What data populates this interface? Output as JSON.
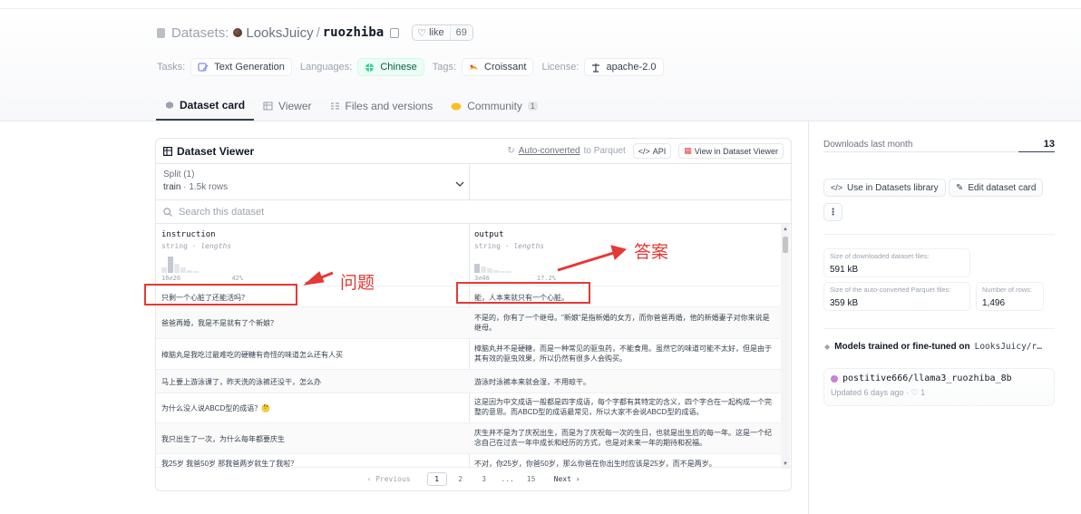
{
  "header": {
    "datasets_label": "Datasets:",
    "owner": "LooksJuicy",
    "slash": "/",
    "repo": "ruozhiba",
    "like_label": "like",
    "like_count": "69"
  },
  "tags": {
    "tasks_label": "Tasks:",
    "task": "Text Generation",
    "languages_label": "Languages:",
    "language": "Chinese",
    "tags_label": "Tags:",
    "tag": "Croissant",
    "license_label": "License:",
    "license": "apache-2.0"
  },
  "tabs": [
    {
      "label": "Dataset card"
    },
    {
      "label": "Viewer"
    },
    {
      "label": "Files and versions"
    },
    {
      "label": "Community",
      "badge": "1"
    }
  ],
  "viewer": {
    "title": "Dataset Viewer",
    "auto_converted_link": "Auto-converted",
    "auto_converted_suffix": "to Parquet",
    "api_label": "API",
    "view_label": "View in Dataset Viewer",
    "split_label": "Split (1)",
    "split_name": "train",
    "split_rows": "· 1.5k rows",
    "search_placeholder": "Search this dataset",
    "columns": [
      {
        "name": "instruction",
        "type": "string",
        "sub": "lengths",
        "min": "16⌀26",
        "pct": "42%"
      },
      {
        "name": "output",
        "type": "string",
        "sub": "lengths",
        "min": "3⌀46",
        "pct": "17.2%"
      }
    ],
    "rows": [
      [
        "只剩一个心脏了还能活吗？",
        "能，人本来就只有一个心脏。"
      ],
      [
        "爸爸再婚，我是不是就有了个新娘？",
        "不是的，你有了一个继母。\"新娘\"是指新婚的女方，而你爸爸再婚，他的新婚妻子对你来说是继母。"
      ],
      [
        "樟脑丸是我吃过最难吃的硬糖有奇怪的味道怎么还有人买",
        "樟脑丸并不是硬糖，而是一种常见的驱虫药，不能食用。虽然它的味道可能不太好，但是由于其有效的驱虫效果，所以仍然有很多人会购买。"
      ],
      [
        "马上要上游泳课了，昨天洗的泳裤还没干，怎么办",
        "游泳时泳裤本来就会湿，不用晾干。"
      ],
      [
        "为什么没人说ABCD型的成语？🤔",
        "这是因为中文成语一般都是四字成语，每个字都有其特定的含义，四个字合在一起构成一个完整的意思。而ABCD型的成语最常见，所以大家不会说ABCD型的成语。"
      ],
      [
        "我只出生了一次，为什么每年都要庆生",
        "庆生并不是为了庆祝出生，而是为了庆祝每一次的生日，也就是出生后的每一年。这是一个纪念自己在过去一年中成长和经历的方式，也是对未来一年的期待和祝福。"
      ],
      [
        "我25岁 我爸50岁 那我爸两岁就生了我啦？",
        "不对，你25岁，你爸50岁，那么你爸在你出生时应该是25岁，而不是两岁。"
      ]
    ],
    "pager": {
      "prev": "‹ Previous",
      "pages": [
        "1",
        "2",
        "3",
        "...",
        "15"
      ],
      "next": "Next ›"
    }
  },
  "sidebar": {
    "downloads_label": "Downloads last month",
    "downloads": "13",
    "use_button": "Use in Datasets library",
    "edit_button": "Edit dataset card",
    "more_button": "⋮",
    "stats": [
      {
        "k": "Size of downloaded dataset files:",
        "v": "591 kB"
      },
      {
        "k": "Size of the auto-converted Parquet files:",
        "v": "359 kB"
      },
      {
        "k": "Number of rows:",
        "v": "1,496"
      }
    ],
    "models_heading": "Models trained or fine-tuned on",
    "models_repo": "LooksJuicy/r…",
    "model_name": "postitive666/llama3_ruozhiba_8b",
    "model_meta": "Updated 6 days ago · ♡ 1"
  },
  "annotations": {
    "question": "问题",
    "answer": "答案",
    "color": "#e53935"
  }
}
